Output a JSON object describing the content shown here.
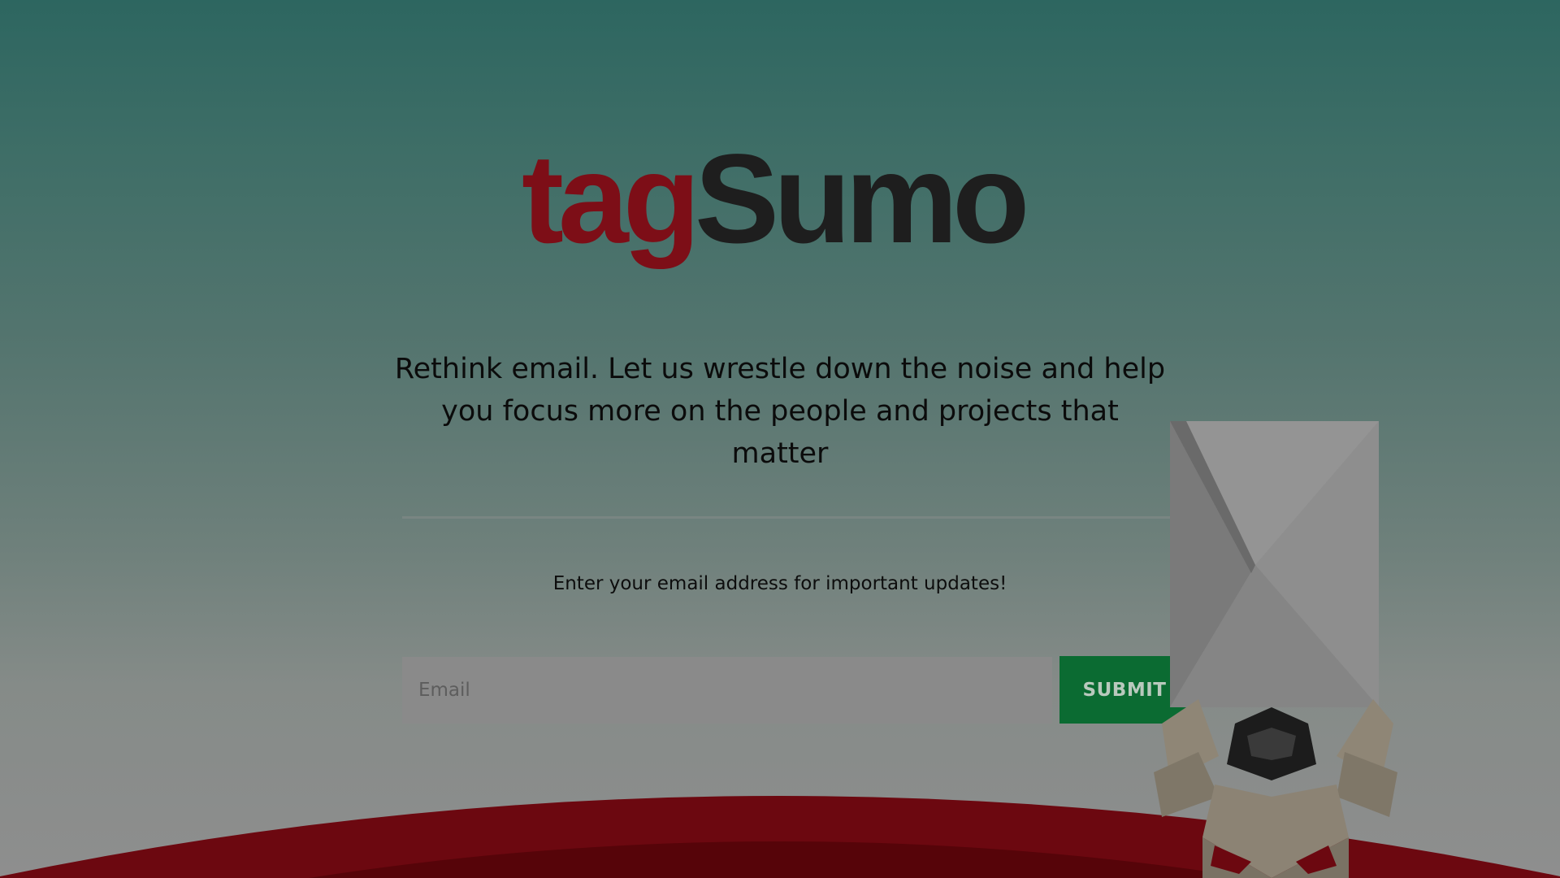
{
  "logo": {
    "part1": "tag",
    "part2": "Sumo"
  },
  "tagline": "Rethink email. Let us wrestle down the noise and help you focus more on the people and projects that matter",
  "signup": {
    "prompt": "Enter your email address for important updates!",
    "email_placeholder": "Email",
    "submit_label": "SUBMIT"
  },
  "colors": {
    "brand_red": "#7d0e17",
    "brand_dark": "#1e1e1e",
    "submit_green": "#0b6b32",
    "background_top": "#2d6660"
  }
}
